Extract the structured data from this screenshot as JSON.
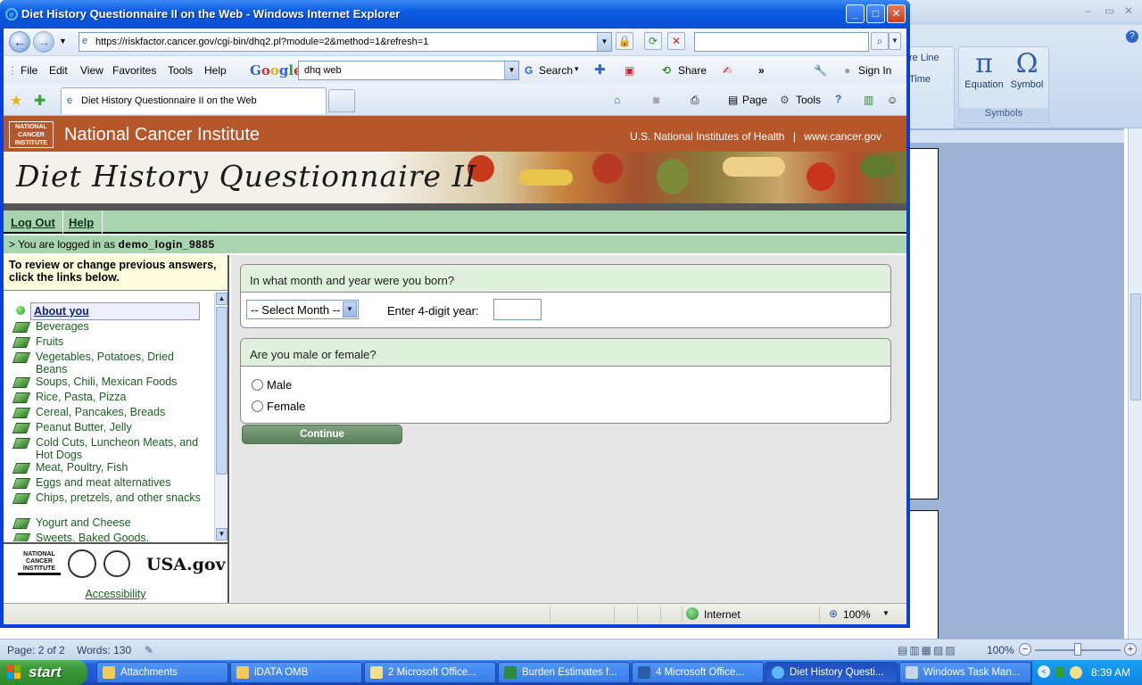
{
  "word": {
    "ribbon_partial": [
      "re Line",
      "Time"
    ],
    "ribbon_buttons": [
      {
        "label": "Equation",
        "glyph": "π"
      },
      {
        "label": "Symbol",
        "glyph": "Ω"
      }
    ],
    "ribbon_group": "Symbols",
    "status_page": "Page: 2 of 2",
    "status_words": "Words: 130",
    "zoom": "100%"
  },
  "ie": {
    "title": "Diet History Questionnaire II on the Web - Windows Internet Explorer",
    "address": "https://riskfactor.cancer.gov/cgi-bin/dhq2.pl?module=2&method=1&refresh=1",
    "menu": [
      "File",
      "Edit",
      "View",
      "Favorites",
      "Tools",
      "Help"
    ],
    "google_label": "Google",
    "google_query": "dhq web",
    "toolbar_search": "Search",
    "toolbar_share": "Share",
    "toolbar_signin": "Sign In",
    "tab_title": "Diet History Questionnaire II on the Web",
    "cmd_page": "Page",
    "cmd_tools": "Tools",
    "status_zone": "Internet",
    "status_zoom": "100%"
  },
  "site": {
    "org_logo": "NATIONAL CANCER INSTITUTE",
    "org_name": "National Cancer Institute",
    "nih_link": "U.S. National Institutes of Health",
    "cancer_link": "www.cancer.gov",
    "banner_title": "Diet History Questionnaire II",
    "nav_logout": "Log Out",
    "nav_help": "Help",
    "login_prefix": "> You are logged in as",
    "login_user": "demo_login_9885",
    "left_header": "To review or change previous answers, click the links below.",
    "sections": [
      "About you",
      "Beverages",
      "Fruits",
      "Vegetables, Potatoes, Dried Beans",
      "Soups, Chili, Mexican Foods",
      "Rice, Pasta, Pizza",
      "Cereal, Pancakes, Breads",
      "Peanut Butter, Jelly",
      "Cold Cuts, Luncheon Meats, and Hot Dogs",
      "Meat, Poultry, Fish",
      "Eggs and meat alternatives",
      "Chips, pretzels, and other snacks",
      "Yogurt and Cheese",
      "Sweets, Baked Goods,"
    ],
    "footer_usa": "USA.gov",
    "accessibility": "Accessibility"
  },
  "questions": {
    "q1": "In what month and year were you born?",
    "month_selected": "-- Select Month --",
    "year_label": "Enter 4-digit year:",
    "year_value": "",
    "q2": "Are you male or female?",
    "options": [
      "Male",
      "Female"
    ],
    "continue_label": "Continue"
  },
  "taskbar": {
    "start": "start",
    "tasks": [
      "Attachments",
      "iDATA OMB",
      "2 Microsoft Office...",
      "Burden Estimates f...",
      "4 Microsoft Office...",
      "Diet History Questi...",
      "Windows Task Man..."
    ],
    "clock": "8:39 AM"
  }
}
